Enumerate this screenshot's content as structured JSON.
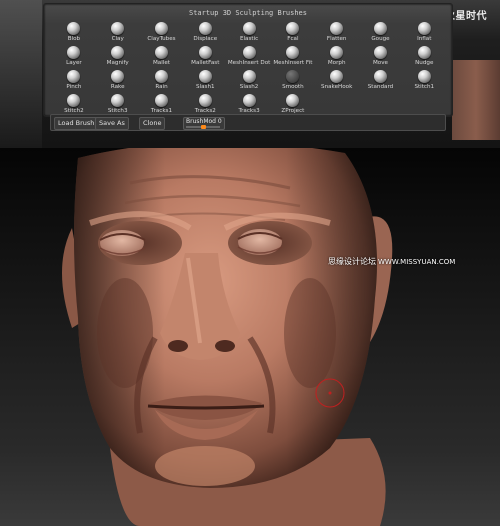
{
  "panel": {
    "title": "Startup 3D Sculpting Brushes",
    "brushes": [
      {
        "label": "Blob"
      },
      {
        "label": "Clay"
      },
      {
        "label": "ClayTubes"
      },
      {
        "label": "Displace"
      },
      {
        "label": "Elastic"
      },
      {
        "label": "Fcal"
      },
      {
        "label": "Flatten"
      },
      {
        "label": "Gouge"
      },
      {
        "label": "Inflat"
      },
      {
        "label": "Layer"
      },
      {
        "label": "Magnify"
      },
      {
        "label": "Mallet"
      },
      {
        "label": "MalletFast"
      },
      {
        "label": "MeshInsert Dot"
      },
      {
        "label": "MeshInsert Fit"
      },
      {
        "label": "Morph"
      },
      {
        "label": "Move"
      },
      {
        "label": "Nudge"
      },
      {
        "label": "Pinch"
      },
      {
        "label": "Rake"
      },
      {
        "label": "Rain"
      },
      {
        "label": "Slash1"
      },
      {
        "label": "Slash2"
      },
      {
        "label": "Smooth"
      },
      {
        "label": "SnakeHook"
      },
      {
        "label": "Standard"
      },
      {
        "label": "Stitch1"
      },
      {
        "label": "Stitch2"
      },
      {
        "label": "Stitch3"
      },
      {
        "label": "Tracks1"
      },
      {
        "label": "Tracks2"
      },
      {
        "label": "Tracks3"
      },
      {
        "label": "ZProject"
      }
    ]
  },
  "toolbar": {
    "load_brush": "Load Brush",
    "save_as": "Save As",
    "clone": "Clone",
    "brushmod_label": "BrushMod 0",
    "brushmod_value": 0.5
  },
  "logo": {
    "text": "火星时代"
  },
  "watermark": {
    "text": "思缘设计论坛",
    "url": "WWW.MISSYUAN.COM"
  },
  "colors": {
    "panel_bg": "#3c3c3c",
    "accent_orange": "#ff8a1a",
    "skin": "#b97a63"
  }
}
